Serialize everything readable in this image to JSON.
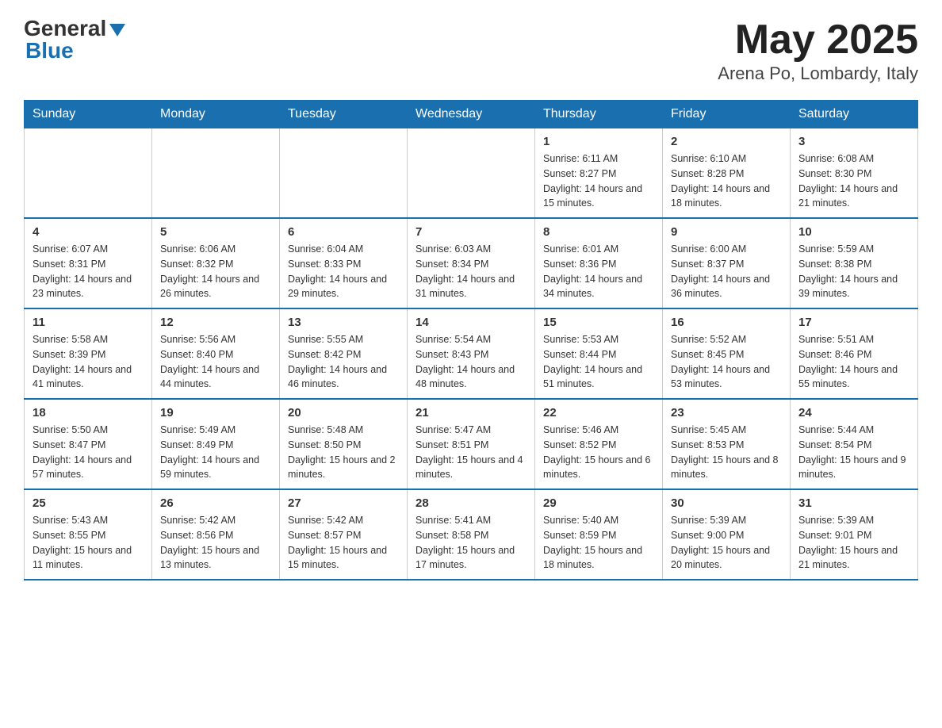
{
  "logo": {
    "general": "General",
    "blue": "Blue",
    "triangle_color": "#1a6faf"
  },
  "title": "May 2025",
  "subtitle": "Arena Po, Lombardy, Italy",
  "days_of_week": [
    "Sunday",
    "Monday",
    "Tuesday",
    "Wednesday",
    "Thursday",
    "Friday",
    "Saturday"
  ],
  "weeks": [
    [
      {
        "day": "",
        "info": ""
      },
      {
        "day": "",
        "info": ""
      },
      {
        "day": "",
        "info": ""
      },
      {
        "day": "",
        "info": ""
      },
      {
        "day": "1",
        "info": "Sunrise: 6:11 AM\nSunset: 8:27 PM\nDaylight: 14 hours and 15 minutes."
      },
      {
        "day": "2",
        "info": "Sunrise: 6:10 AM\nSunset: 8:28 PM\nDaylight: 14 hours and 18 minutes."
      },
      {
        "day": "3",
        "info": "Sunrise: 6:08 AM\nSunset: 8:30 PM\nDaylight: 14 hours and 21 minutes."
      }
    ],
    [
      {
        "day": "4",
        "info": "Sunrise: 6:07 AM\nSunset: 8:31 PM\nDaylight: 14 hours and 23 minutes."
      },
      {
        "day": "5",
        "info": "Sunrise: 6:06 AM\nSunset: 8:32 PM\nDaylight: 14 hours and 26 minutes."
      },
      {
        "day": "6",
        "info": "Sunrise: 6:04 AM\nSunset: 8:33 PM\nDaylight: 14 hours and 29 minutes."
      },
      {
        "day": "7",
        "info": "Sunrise: 6:03 AM\nSunset: 8:34 PM\nDaylight: 14 hours and 31 minutes."
      },
      {
        "day": "8",
        "info": "Sunrise: 6:01 AM\nSunset: 8:36 PM\nDaylight: 14 hours and 34 minutes."
      },
      {
        "day": "9",
        "info": "Sunrise: 6:00 AM\nSunset: 8:37 PM\nDaylight: 14 hours and 36 minutes."
      },
      {
        "day": "10",
        "info": "Sunrise: 5:59 AM\nSunset: 8:38 PM\nDaylight: 14 hours and 39 minutes."
      }
    ],
    [
      {
        "day": "11",
        "info": "Sunrise: 5:58 AM\nSunset: 8:39 PM\nDaylight: 14 hours and 41 minutes."
      },
      {
        "day": "12",
        "info": "Sunrise: 5:56 AM\nSunset: 8:40 PM\nDaylight: 14 hours and 44 minutes."
      },
      {
        "day": "13",
        "info": "Sunrise: 5:55 AM\nSunset: 8:42 PM\nDaylight: 14 hours and 46 minutes."
      },
      {
        "day": "14",
        "info": "Sunrise: 5:54 AM\nSunset: 8:43 PM\nDaylight: 14 hours and 48 minutes."
      },
      {
        "day": "15",
        "info": "Sunrise: 5:53 AM\nSunset: 8:44 PM\nDaylight: 14 hours and 51 minutes."
      },
      {
        "day": "16",
        "info": "Sunrise: 5:52 AM\nSunset: 8:45 PM\nDaylight: 14 hours and 53 minutes."
      },
      {
        "day": "17",
        "info": "Sunrise: 5:51 AM\nSunset: 8:46 PM\nDaylight: 14 hours and 55 minutes."
      }
    ],
    [
      {
        "day": "18",
        "info": "Sunrise: 5:50 AM\nSunset: 8:47 PM\nDaylight: 14 hours and 57 minutes."
      },
      {
        "day": "19",
        "info": "Sunrise: 5:49 AM\nSunset: 8:49 PM\nDaylight: 14 hours and 59 minutes."
      },
      {
        "day": "20",
        "info": "Sunrise: 5:48 AM\nSunset: 8:50 PM\nDaylight: 15 hours and 2 minutes."
      },
      {
        "day": "21",
        "info": "Sunrise: 5:47 AM\nSunset: 8:51 PM\nDaylight: 15 hours and 4 minutes."
      },
      {
        "day": "22",
        "info": "Sunrise: 5:46 AM\nSunset: 8:52 PM\nDaylight: 15 hours and 6 minutes."
      },
      {
        "day": "23",
        "info": "Sunrise: 5:45 AM\nSunset: 8:53 PM\nDaylight: 15 hours and 8 minutes."
      },
      {
        "day": "24",
        "info": "Sunrise: 5:44 AM\nSunset: 8:54 PM\nDaylight: 15 hours and 9 minutes."
      }
    ],
    [
      {
        "day": "25",
        "info": "Sunrise: 5:43 AM\nSunset: 8:55 PM\nDaylight: 15 hours and 11 minutes."
      },
      {
        "day": "26",
        "info": "Sunrise: 5:42 AM\nSunset: 8:56 PM\nDaylight: 15 hours and 13 minutes."
      },
      {
        "day": "27",
        "info": "Sunrise: 5:42 AM\nSunset: 8:57 PM\nDaylight: 15 hours and 15 minutes."
      },
      {
        "day": "28",
        "info": "Sunrise: 5:41 AM\nSunset: 8:58 PM\nDaylight: 15 hours and 17 minutes."
      },
      {
        "day": "29",
        "info": "Sunrise: 5:40 AM\nSunset: 8:59 PM\nDaylight: 15 hours and 18 minutes."
      },
      {
        "day": "30",
        "info": "Sunrise: 5:39 AM\nSunset: 9:00 PM\nDaylight: 15 hours and 20 minutes."
      },
      {
        "day": "31",
        "info": "Sunrise: 5:39 AM\nSunset: 9:01 PM\nDaylight: 15 hours and 21 minutes."
      }
    ]
  ]
}
